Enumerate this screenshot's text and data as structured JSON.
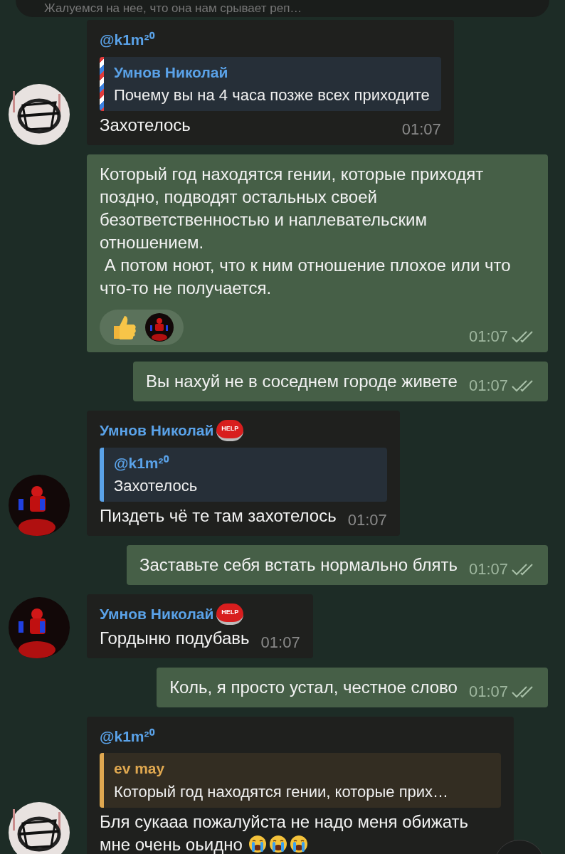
{
  "pinned_bar": {
    "text": "Жалуемся на нее, что она нам срывает реп…"
  },
  "messages": [
    {
      "kind": "incoming",
      "avatar": {
        "kind": "light"
      },
      "sender": "@k1m²⁰",
      "quote": {
        "author": "Умнов Николай",
        "text": "Почему вы на 4 часа позже всех приходите",
        "color": "#5aa2e8",
        "striped": true
      },
      "text": "Захотелось",
      "time": "01:07"
    },
    {
      "kind": "outgoing",
      "text": "Который год находятся гении, которые приходят поздно, подводят остальных своей безответственностью и наплевательским отношением.\n А потом ноют, что к ним отношение плохое или что что-то не получается.",
      "reactions": [
        {
          "kind": "thumbs-up"
        },
        {
          "kind": "avatar"
        }
      ],
      "time": "01:07",
      "read": true
    },
    {
      "kind": "outgoing",
      "text": "Вы нахуй не в соседнем городе живете",
      "time": "01:07",
      "read": true
    },
    {
      "kind": "incoming",
      "avatar": {
        "kind": "dark"
      },
      "sender": "Умнов Николай",
      "sender_badge": "HELP",
      "quote": {
        "author": "@k1m²⁰",
        "text": "Захотелось",
        "color": "#5aa2e8",
        "striped": false
      },
      "text": "Пиздеть чё те там захотелось",
      "time": "01:07"
    },
    {
      "kind": "outgoing",
      "text": "Заставьте себя встать нормально блять",
      "time": "01:07",
      "read": true
    },
    {
      "kind": "incoming",
      "avatar": {
        "kind": "dark"
      },
      "sender": "Умнов Николай",
      "sender_badge": "HELP",
      "text": "Гордыню подубавь",
      "time": "01:07"
    },
    {
      "kind": "outgoing",
      "text": "Коль, я просто устал, честное слово",
      "time": "01:07",
      "read": true
    },
    {
      "kind": "incoming",
      "avatar": {
        "kind": "light"
      },
      "sender": "@k1m²⁰",
      "quote": {
        "author": "ev may",
        "text": "Который год находятся гении, которые прих…",
        "color": "#e0a850",
        "striped": false
      },
      "text": "Бля сукааа пожалуйста не надо меня обижать мне очень оьидно",
      "emojis": [
        {
          "kind": "crying"
        },
        {
          "kind": "crying"
        },
        {
          "kind": "crying"
        }
      ]
    }
  ]
}
